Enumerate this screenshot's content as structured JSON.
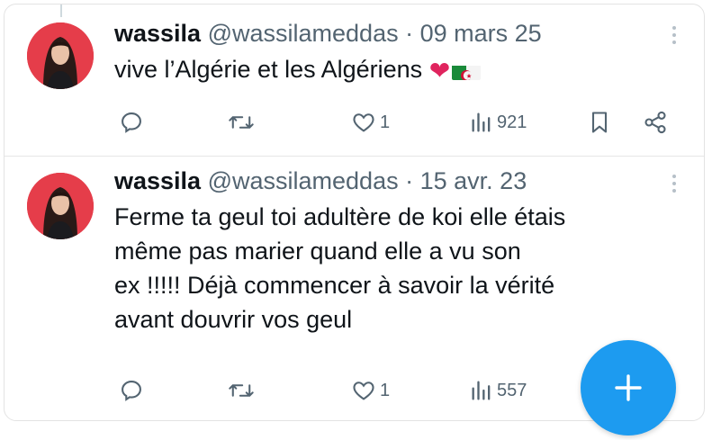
{
  "tweets": [
    {
      "display_name": "wassila",
      "handle": "@wassilameddas",
      "separator": "·",
      "date": "09 mars 25",
      "text": "vive l’Algérie et les Algériens",
      "emojis": [
        "red-heart",
        "algeria-flag"
      ],
      "stats": {
        "replies": "",
        "retweets": "",
        "likes": "1",
        "views": "921"
      },
      "has_bookmark": true,
      "has_share": true
    },
    {
      "display_name": "wassila",
      "handle": "@wassilameddas",
      "separator": "·",
      "date": "15 avr. 23",
      "text_lines": [
        "Ferme ta geul toi adultère de koi elle étais",
        "même pas marier quand elle a vu son",
        "ex !!!!! Déjà commencer à savoir la vérité",
        "avant douvrir vos geul"
      ],
      "stats": {
        "replies": "",
        "retweets": "",
        "likes": "1",
        "views": "557"
      }
    }
  ],
  "colors": {
    "accent": "#1d9bf0",
    "text": "#0f1419",
    "muted": "#536471",
    "avatar_bg": "#e53d4a",
    "heart": "#e0245e"
  },
  "compose_button": {
    "icon": "plus-icon"
  }
}
